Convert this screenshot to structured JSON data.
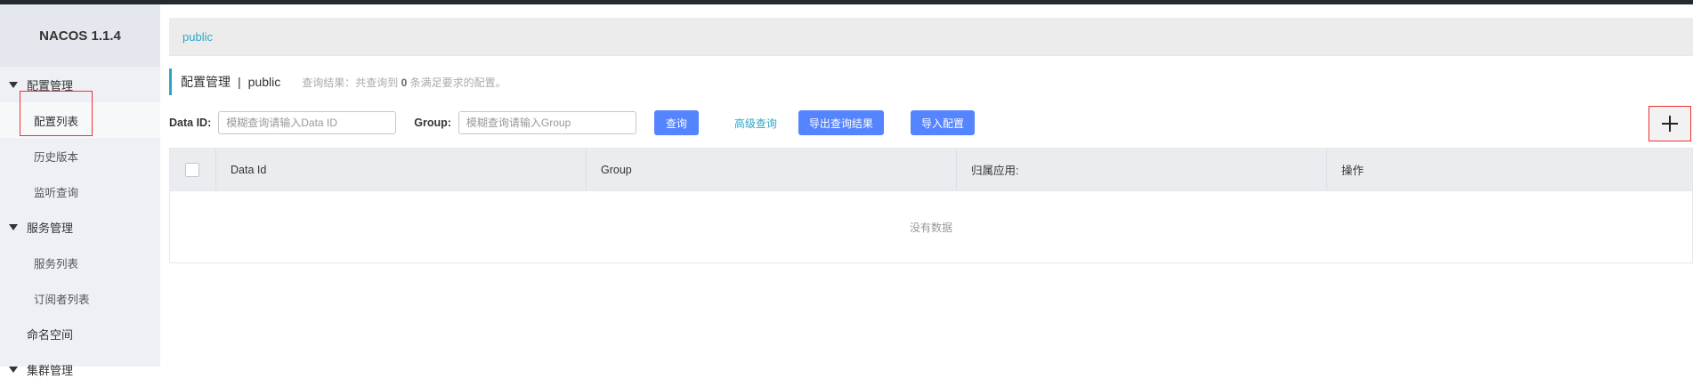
{
  "brand": {
    "title": "NACOS 1.1.4"
  },
  "sidebar": {
    "groups": [
      {
        "label": "配置管理",
        "items": [
          "配置列表",
          "历史版本",
          "监听查询"
        ]
      },
      {
        "label": "服务管理",
        "items": [
          "服务列表",
          "订阅者列表"
        ]
      }
    ],
    "namespace": "命名空间",
    "cut_group": "集群管理"
  },
  "breadcrumb": {
    "label": "public"
  },
  "page": {
    "title": "配置管理",
    "separator": "|",
    "namespace": "public",
    "hint_prefix": "查询结果：共查询到",
    "hint_count": "0",
    "hint_suffix": "条满足要求的配置。"
  },
  "search": {
    "dataid_label": "Data ID:",
    "dataid_placeholder": "模糊查询请输入Data ID",
    "group_label": "Group:",
    "group_placeholder": "模糊查询请输入Group",
    "query_label": "查询",
    "advanced_label": "高级查询",
    "export_label": "导出查询结果",
    "import_label": "导入配置"
  },
  "table": {
    "columns": [
      "Data Id",
      "Group",
      "归属应用:",
      "操作"
    ],
    "empty_text": "没有数据"
  },
  "icons": {
    "add": "plus-icon",
    "collapse": "caret-down-icon",
    "checkbox": "checkbox-icon"
  },
  "colors": {
    "accent": "#2ba7c6",
    "button": "#5584ff",
    "highlight": "#e33333"
  }
}
